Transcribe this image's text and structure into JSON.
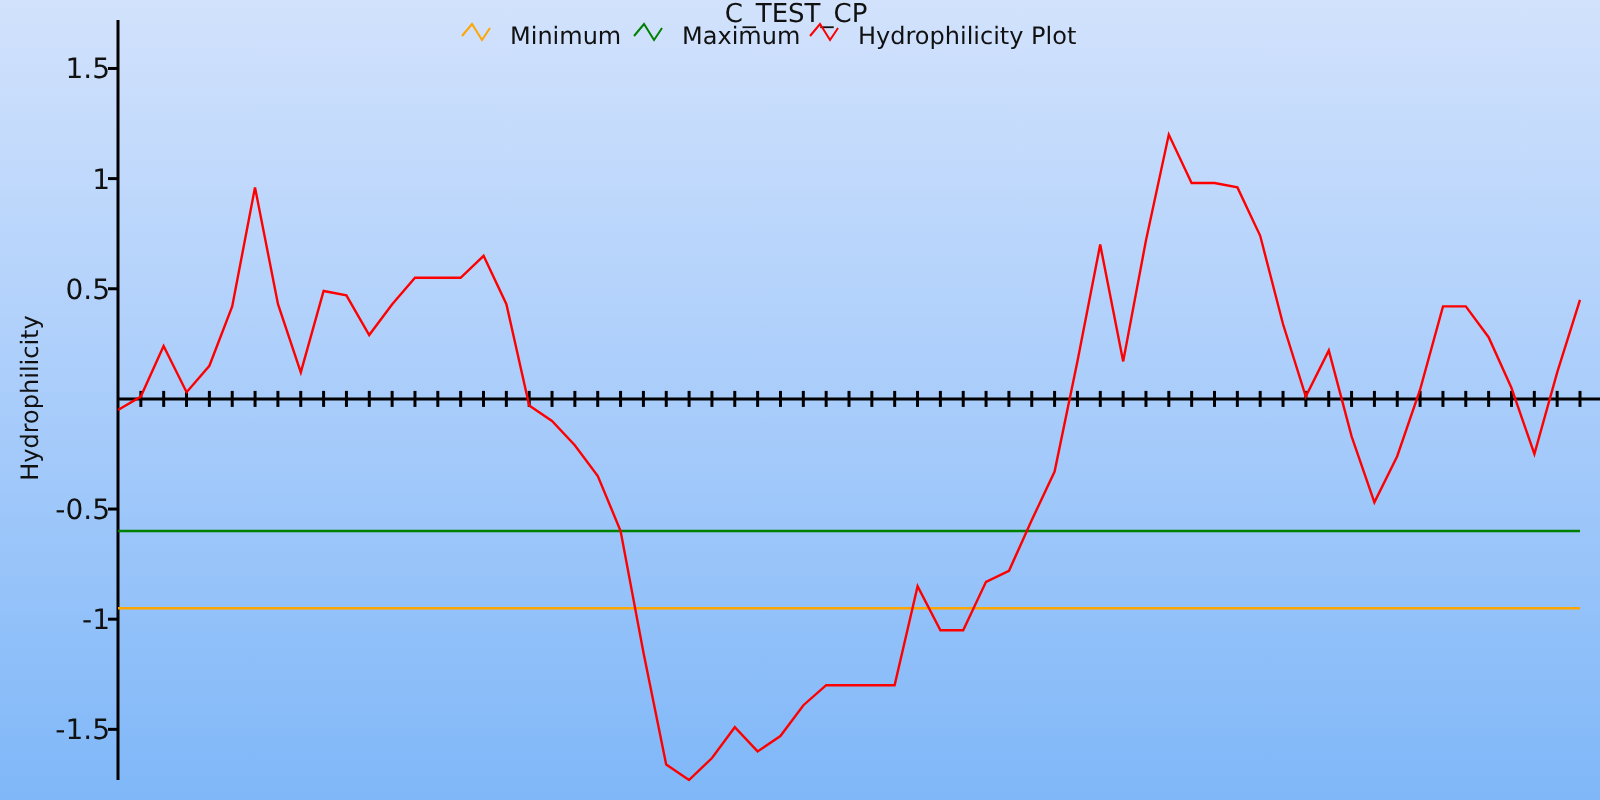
{
  "chart_data": {
    "type": "line",
    "title": "C_TEST_CP",
    "ylabel": "Hydrophilicity",
    "legend": true,
    "ylim": [
      -1.73,
      1.72
    ],
    "yticks": [
      -1.5,
      -1,
      -0.5,
      0.5,
      1,
      1.5
    ],
    "series": [
      {
        "name": "Minimum",
        "color": "#ffa500",
        "values": [
          -0.95,
          -0.95,
          -0.95,
          -0.95,
          -0.95,
          -0.95,
          -0.95,
          -0.95,
          -0.95,
          -0.95,
          -0.95,
          -0.95,
          -0.95,
          -0.95,
          -0.95,
          -0.95,
          -0.95,
          -0.95,
          -0.95,
          -0.95,
          -0.95,
          -0.95,
          -0.95,
          -0.95,
          -0.95,
          -0.95,
          -0.95,
          -0.95,
          -0.95,
          -0.95,
          -0.95,
          -0.95,
          -0.95,
          -0.95,
          -0.95,
          -0.95,
          -0.95,
          -0.95,
          -0.95,
          -0.95,
          -0.95,
          -0.95,
          -0.95,
          -0.95,
          -0.95,
          -0.95,
          -0.95,
          -0.95,
          -0.95,
          -0.95,
          -0.95,
          -0.95,
          -0.95,
          -0.95,
          -0.95,
          -0.95,
          -0.95,
          -0.95,
          -0.95,
          -0.95,
          -0.95,
          -0.95,
          -0.95,
          -0.95,
          -0.95
        ]
      },
      {
        "name": "Maximum",
        "color": "#008000",
        "values": [
          -0.6,
          -0.6,
          -0.6,
          -0.6,
          -0.6,
          -0.6,
          -0.6,
          -0.6,
          -0.6,
          -0.6,
          -0.6,
          -0.6,
          -0.6,
          -0.6,
          -0.6,
          -0.6,
          -0.6,
          -0.6,
          -0.6,
          -0.6,
          -0.6,
          -0.6,
          -0.6,
          -0.6,
          -0.6,
          -0.6,
          -0.6,
          -0.6,
          -0.6,
          -0.6,
          -0.6,
          -0.6,
          -0.6,
          -0.6,
          -0.6,
          -0.6,
          -0.6,
          -0.6,
          -0.6,
          -0.6,
          -0.6,
          -0.6,
          -0.6,
          -0.6,
          -0.6,
          -0.6,
          -0.6,
          -0.6,
          -0.6,
          -0.6,
          -0.6,
          -0.6,
          -0.6,
          -0.6,
          -0.6,
          -0.6,
          -0.6,
          -0.6,
          -0.6,
          -0.6,
          -0.6,
          -0.6,
          -0.6,
          -0.6,
          -0.6
        ]
      },
      {
        "name": "Hydrophilicity Plot",
        "color": "#ff0000",
        "values": [
          -0.05,
          0.01,
          0.24,
          0.03,
          0.15,
          0.42,
          0.96,
          0.43,
          0.12,
          0.49,
          0.47,
          0.29,
          0.43,
          0.55,
          0.55,
          0.55,
          0.65,
          0.43,
          -0.03,
          -0.1,
          -0.21,
          -0.35,
          -0.6,
          -1.15,
          -1.66,
          -1.73,
          -1.63,
          -1.49,
          -1.6,
          -1.53,
          -1.39,
          -1.3,
          -1.3,
          -1.3,
          -1.3,
          -0.85,
          -1.05,
          -1.05,
          -0.83,
          -0.78,
          -0.55,
          -0.33,
          0.17,
          0.7,
          0.17,
          0.72,
          1.2,
          0.98,
          0.98,
          0.96,
          0.74,
          0.34,
          0.01,
          0.22,
          -0.17,
          -0.47,
          -0.26,
          0.04,
          0.42,
          0.42,
          0.28,
          0.05,
          -0.25,
          0.12,
          0.45
        ]
      }
    ]
  }
}
